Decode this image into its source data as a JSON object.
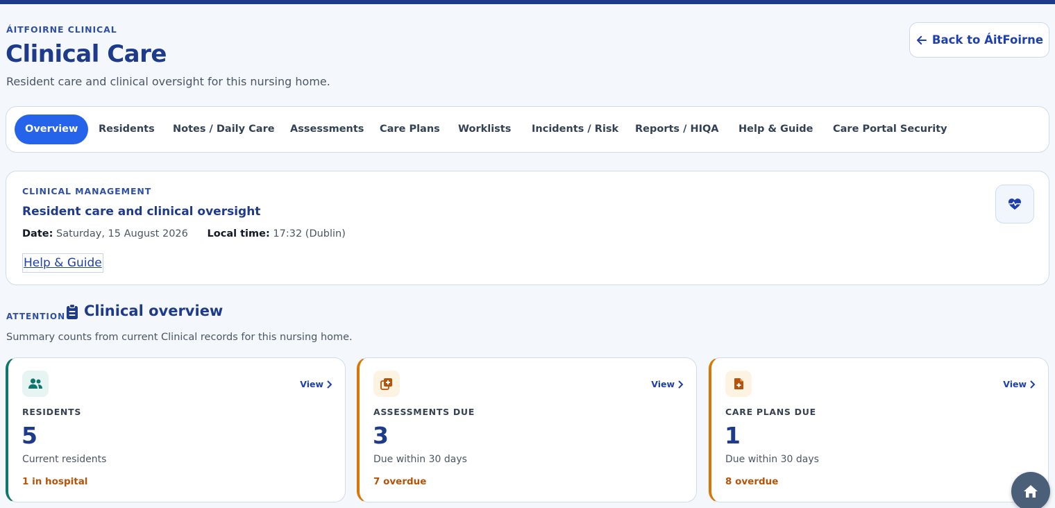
{
  "header": {
    "eyebrow": "ÁITFOIRNE CLINICAL",
    "title": "Clinical Care",
    "subtitle": "Resident care and clinical oversight for this nursing home.",
    "back_label": "Back to ÁitFoirne"
  },
  "tabs": [
    {
      "label": "Overview",
      "active": true
    },
    {
      "label": "Residents"
    },
    {
      "label": "Notes / Daily Care"
    },
    {
      "label": "Assessments"
    },
    {
      "label": "Care Plans"
    },
    {
      "label": "Worklists"
    },
    {
      "label": "Incidents / Risk"
    },
    {
      "label": "Reports / HIQA"
    },
    {
      "label": "Help & Guide"
    },
    {
      "label": "Care Portal Security"
    }
  ],
  "management": {
    "eyebrow": "CLINICAL MANAGEMENT",
    "title": "Resident care and clinical oversight",
    "date_label": "Date:",
    "date_value": "Saturday, 15 August 2026",
    "time_label": "Local time:",
    "time_value": "17:32 (Dublin)",
    "help_link": "Help & Guide",
    "icon": "heart-pulse-icon"
  },
  "attention": {
    "eyebrow": "ATTENTION",
    "title": "Clinical overview",
    "subtitle": "Summary counts from current Clinical records for this nursing home.",
    "icon": "clipboard-icon"
  },
  "stats": [
    {
      "label": "RESIDENTS",
      "value": "5",
      "desc": "Current residents",
      "note": "1 in hospital",
      "view": "View",
      "accent": "#0f766e",
      "icon": "users-icon"
    },
    {
      "label": "ASSESSMENTS DUE",
      "value": "3",
      "desc": "Due within 30 days",
      "note": "7 overdue",
      "view": "View",
      "accent": "#d97706",
      "icon": "medical-copy-icon"
    },
    {
      "label": "CARE PLANS DUE",
      "value": "1",
      "desc": "Due within 30 days",
      "note": "8 overdue",
      "view": "View",
      "accent": "#d97706",
      "icon": "file-medical-icon"
    }
  ],
  "colors": {
    "primary": "#1e3a8a",
    "accent": "#2563eb",
    "warning": "#b45309"
  }
}
